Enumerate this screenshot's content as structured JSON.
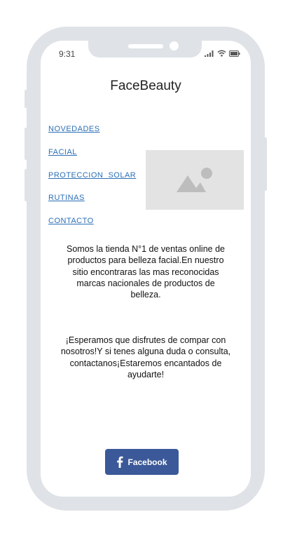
{
  "status_bar": {
    "time": "9:31"
  },
  "header": {
    "title": "FaceBeauty"
  },
  "nav": {
    "items": [
      {
        "label": "NOVEDADES"
      },
      {
        "label": "FACIAL"
      },
      {
        "label": "PROTECCION  SOLAR"
      },
      {
        "label": "RUTINAS"
      },
      {
        "label": "CONTACTO"
      }
    ]
  },
  "main": {
    "intro_lines": [
      "Somos la tienda N°1 de ventas online de",
      "productos para belleza facial.En nuestro",
      "sitio encontraras las mas reconocidas",
      "marcas nacionales de productos de",
      "belleza."
    ],
    "closing_lines": [
      "¡Esperamos que disfrutes de compar con",
      "nosotros!Y si tenes alguna duda o consulta,",
      "contactanos¡Estaremos encantados de",
      "ayudarte!"
    ]
  },
  "footer": {
    "facebook_label": "Facebook",
    "facebook_color": "#3b5998"
  },
  "colors": {
    "device_frame": "#dfe2e6",
    "link": "#2b6fb6",
    "image_placeholder": "#e3e3e3"
  },
  "icons": [
    "signal-icon",
    "wifi-icon",
    "battery-icon",
    "image-placeholder-icon",
    "facebook-icon"
  ]
}
